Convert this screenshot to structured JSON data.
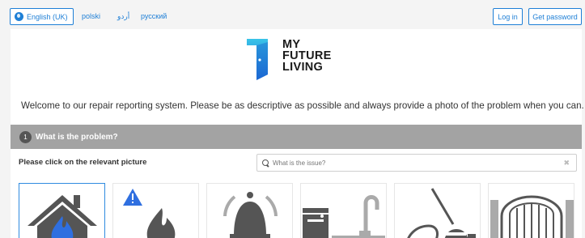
{
  "header": {
    "language_selected": "English (UK)",
    "language_links": [
      "polski",
      "أردو",
      "русский"
    ],
    "login_label": "Log in",
    "get_password_label": "Get password"
  },
  "logo": {
    "lines": [
      "MY",
      "FUTURE",
      "LIVING"
    ]
  },
  "welcome_text": "Welcome to our repair reporting system. Please be as descriptive as possible and always provide a photo of the problem when you can.",
  "step": {
    "number": "1",
    "title": "What is the problem?"
  },
  "instruction": "Please click on the relevant picture",
  "search": {
    "placeholder": "What is the issue?"
  },
  "categories": [
    {
      "icon": "house-fire-icon",
      "selected": true
    },
    {
      "icon": "gas-warning-icon",
      "selected": false
    },
    {
      "icon": "alarm-bell-icon",
      "selected": false
    },
    {
      "icon": "kitchen-sink-icon",
      "selected": false
    },
    {
      "icon": "cleaning-icon",
      "selected": false
    },
    {
      "icon": "gate-icon",
      "selected": false
    }
  ],
  "colors": {
    "accent": "#1e7fd6",
    "section_bar": "#a3a3a3",
    "icon_gray": "#555555",
    "fire_blue": "#2f6fe0"
  }
}
